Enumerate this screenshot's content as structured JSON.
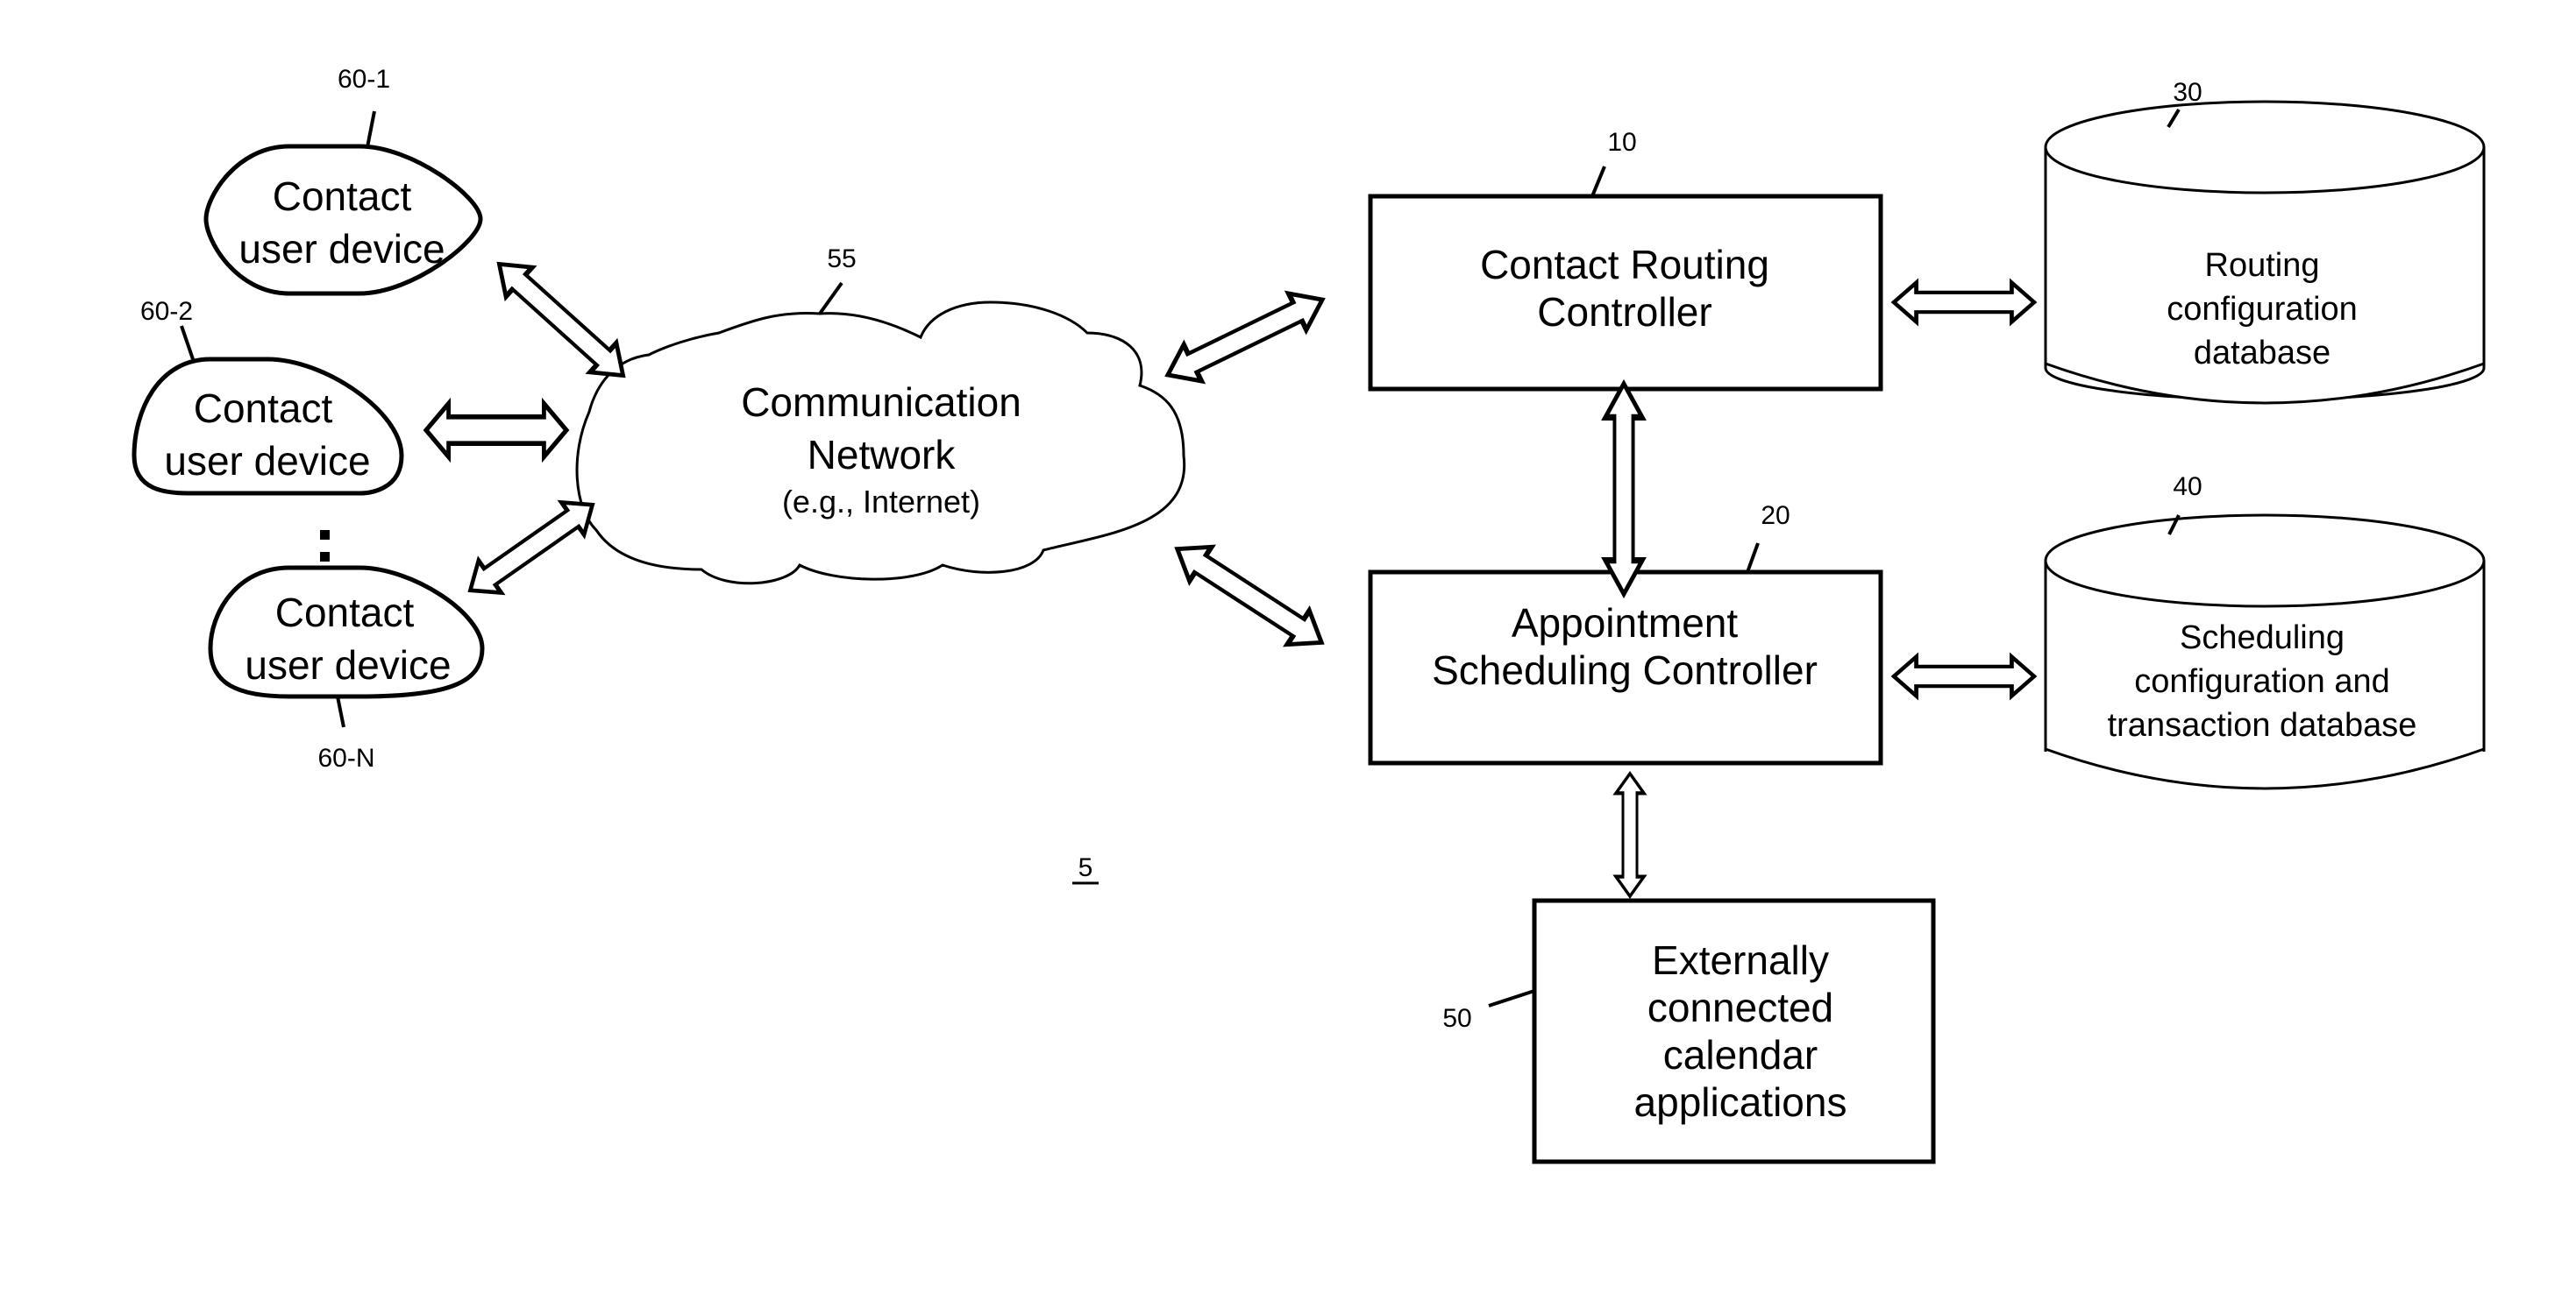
{
  "figure": {
    "figure_number": "5",
    "colors": {
      "stroke": "#000000",
      "background": "#ffffff"
    }
  },
  "devices": [
    {
      "ref": "60-1",
      "line1": "Contact",
      "line2": "user device"
    },
    {
      "ref": "60-2",
      "line1": "Contact",
      "line2": "user device"
    },
    {
      "ref": "60-N",
      "line1": "Contact",
      "line2": "user device"
    }
  ],
  "ellipsis": "vertical-dots",
  "network": {
    "ref": "55",
    "line1": "Communication",
    "line2": "Network",
    "line3": "(e.g., Internet)"
  },
  "routing_controller": {
    "ref": "10",
    "line1": "Contact Routing",
    "line2": "Controller"
  },
  "scheduling_controller": {
    "ref": "20",
    "line1": "Appointment",
    "line2": "Scheduling Controller"
  },
  "routing_db": {
    "ref": "30",
    "line1": "Routing",
    "line2": "configuration",
    "line3": "database"
  },
  "scheduling_db": {
    "ref": "40",
    "line1": "Scheduling",
    "line2": "configuration and",
    "line3": "transaction database"
  },
  "calendar_apps": {
    "ref": "50",
    "line1": "Externally",
    "line2": "connected",
    "line3": "calendar",
    "line4": "applications"
  },
  "connections": [
    {
      "from": "60-1",
      "to": "55",
      "type": "bidirectional"
    },
    {
      "from": "60-2",
      "to": "55",
      "type": "bidirectional"
    },
    {
      "from": "60-N",
      "to": "55",
      "type": "bidirectional"
    },
    {
      "from": "55",
      "to": "10",
      "type": "bidirectional"
    },
    {
      "from": "55",
      "to": "20",
      "type": "bidirectional"
    },
    {
      "from": "10",
      "to": "30",
      "type": "bidirectional"
    },
    {
      "from": "10",
      "to": "20",
      "type": "bidirectional"
    },
    {
      "from": "20",
      "to": "40",
      "type": "bidirectional"
    },
    {
      "from": "20",
      "to": "50",
      "type": "bidirectional"
    }
  ]
}
